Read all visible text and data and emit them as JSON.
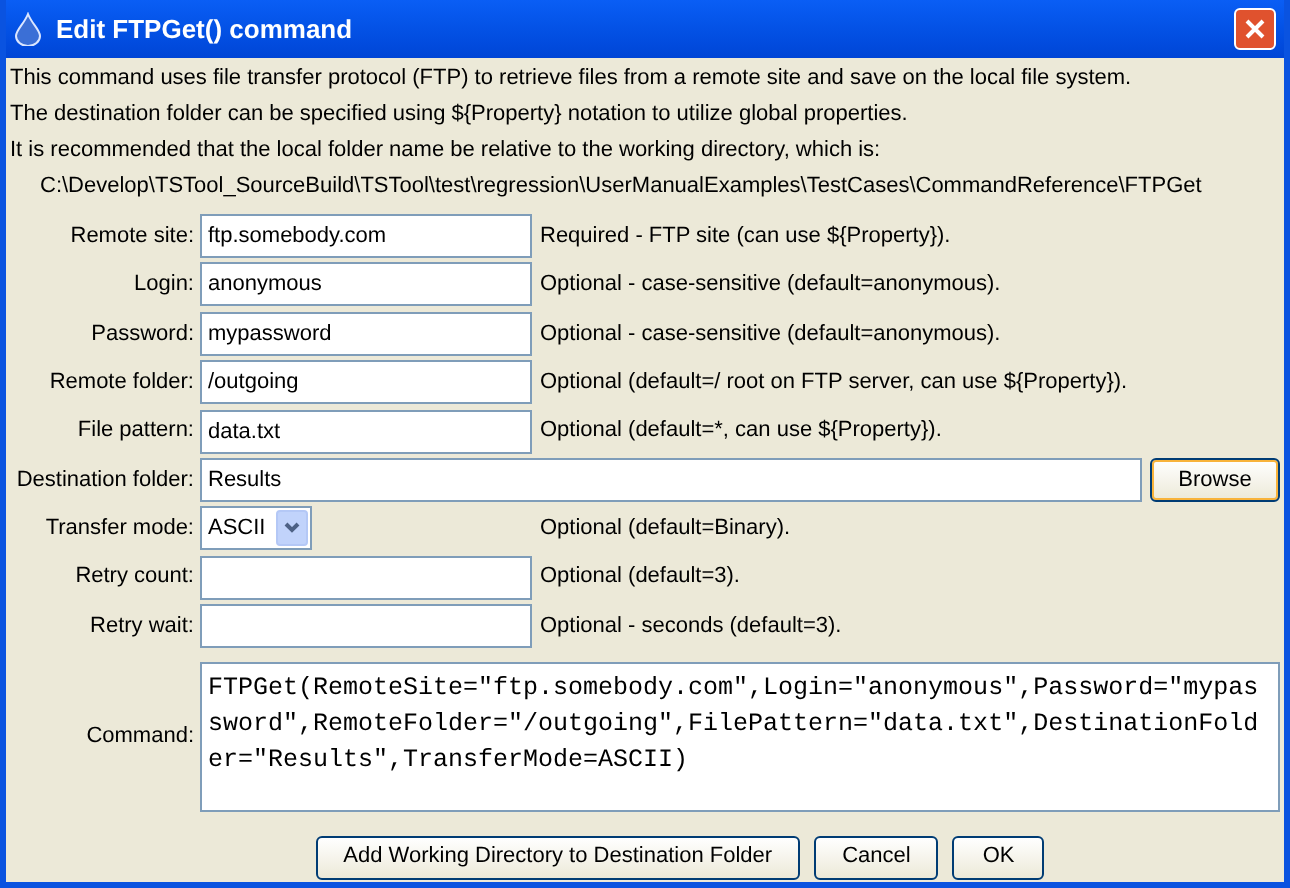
{
  "window": {
    "title": "Edit FTPGet() command"
  },
  "description": [
    "This command uses file transfer protocol (FTP) to retrieve files from a remote site and save on the local file system.",
    "The destination folder can be specified using ${Property} notation to utilize global properties.",
    "It is recommended that the local folder name be relative to the working directory, which is:"
  ],
  "working_directory": "C:\\Develop\\TSTool_SourceBuild\\TSTool\\test\\regression\\UserManualExamples\\TestCases\\CommandReference\\FTPGet",
  "fields": [
    {
      "kind": "text",
      "label": "Remote site:",
      "value": "ftp.somebody.com",
      "note": "Required - FTP site (can use ${Property})."
    },
    {
      "kind": "text",
      "label": "Login:",
      "value": "anonymous",
      "note": "Optional - case-sensitive (default=anonymous)."
    },
    {
      "kind": "text",
      "label": "Password:",
      "value": "mypassword",
      "note": "Optional - case-sensitive (default=anonymous)."
    },
    {
      "kind": "text",
      "label": "Remote folder:",
      "value": "/outgoing",
      "note": "Optional (default=/ root on FTP server, can use ${Property})."
    },
    {
      "kind": "text",
      "label": "File pattern:",
      "value": "data.txt",
      "note": "Optional (default=*, can use ${Property})."
    },
    {
      "kind": "browse",
      "label": "Destination folder:",
      "value": "Results",
      "button": "Browse"
    },
    {
      "kind": "select",
      "label": "Transfer mode:",
      "value": "ASCII",
      "note": "Optional (default=Binary)."
    },
    {
      "kind": "text",
      "label": "Retry count:",
      "note": "Optional (default=3)."
    },
    {
      "kind": "text",
      "label": "Retry wait:",
      "note": "Optional - seconds (default=3)."
    },
    {
      "kind": "command",
      "label": "Command:",
      "value": "FTPGet(RemoteSite=\"ftp.somebody.com\",Login=\"anonymous\",Password=\"mypassword\",RemoteFolder=\"/outgoing\",FilePattern=\"data.txt\",DestinationFolder=\"Results\",TransferMode=ASCII)"
    }
  ],
  "buttons": [
    "Add Working Directory to Destination Folder",
    "Cancel",
    "OK"
  ]
}
